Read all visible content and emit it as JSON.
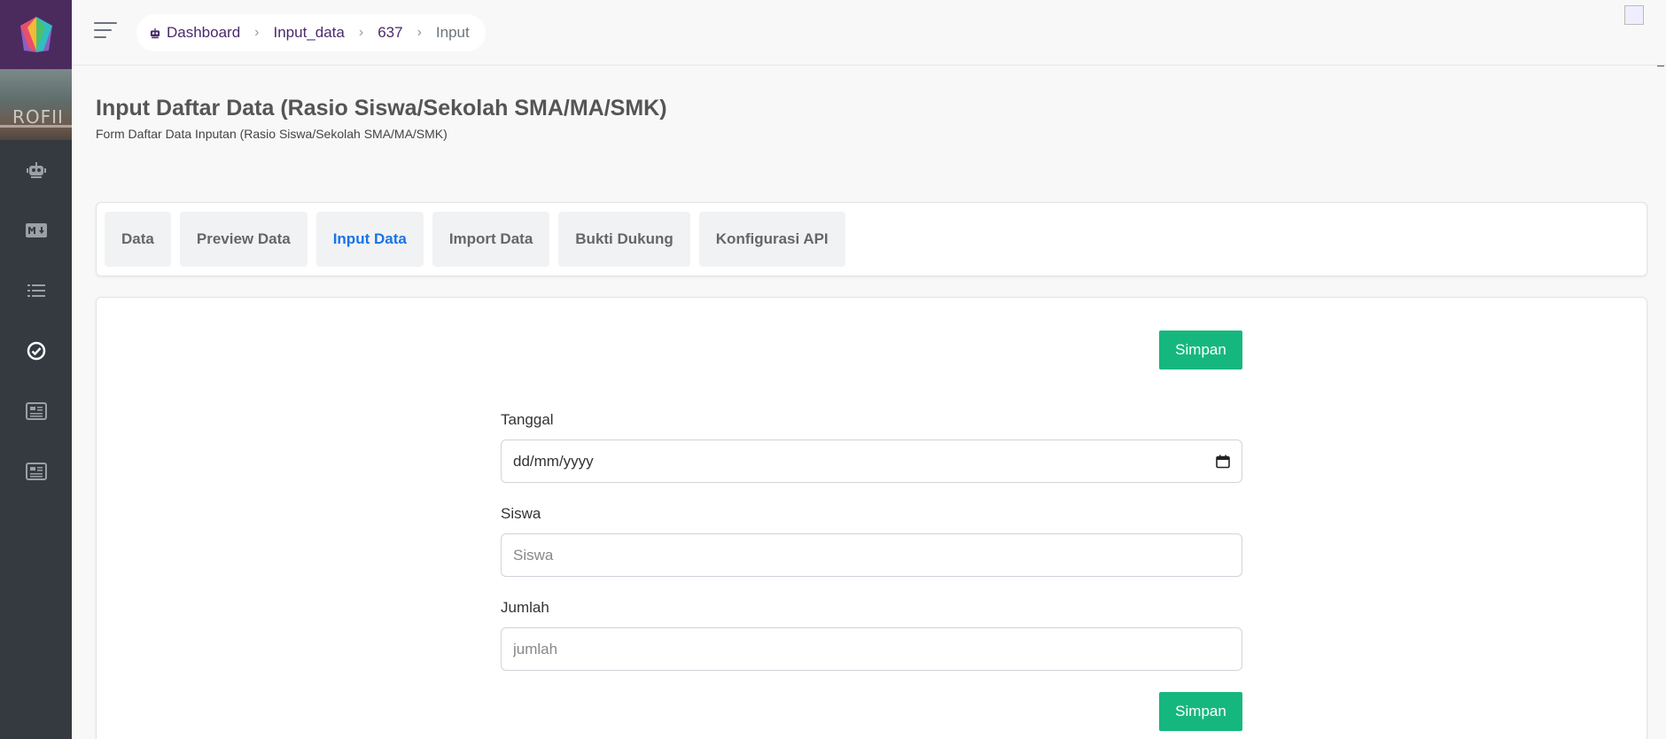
{
  "sidebar": {
    "items": [
      {
        "icon": "robot-icon"
      },
      {
        "icon": "markdown-icon"
      },
      {
        "icon": "list-icon"
      },
      {
        "icon": "check-circle-icon"
      },
      {
        "icon": "newspaper-icon"
      },
      {
        "icon": "newspaper-icon"
      }
    ],
    "banner_text": "ROFII"
  },
  "breadcrumb": {
    "items": [
      "Dashboard",
      "Input_data",
      "637"
    ],
    "current": "Input"
  },
  "page": {
    "title": "Input Daftar Data (Rasio Siswa/Sekolah SMA/MA/SMK)",
    "subtitle": "Form Daftar Data Inputan (Rasio Siswa/Sekolah SMA/MA/SMK)"
  },
  "tabs": [
    {
      "label": "Data",
      "active": false
    },
    {
      "label": "Preview Data",
      "active": false
    },
    {
      "label": "Input Data",
      "active": true
    },
    {
      "label": "Import Data",
      "active": false
    },
    {
      "label": "Bukti Dukung",
      "active": false
    },
    {
      "label": "Konfigurasi API",
      "active": false
    }
  ],
  "form": {
    "save_label": "Simpan",
    "tanggal": {
      "label": "Tanggal",
      "value": "dd/mm/yyyy"
    },
    "siswa": {
      "label": "Siswa",
      "placeholder": "Siswa"
    },
    "jumlah": {
      "label": "Jumlah",
      "placeholder": "jumlah"
    }
  },
  "colors": {
    "sidebar_bg": "#343a40",
    "logo_bg": "#4b2a5e",
    "accent_green": "#16b77e",
    "active_tab": "#1a73e8",
    "breadcrumb_link": "#4a2a6b"
  }
}
